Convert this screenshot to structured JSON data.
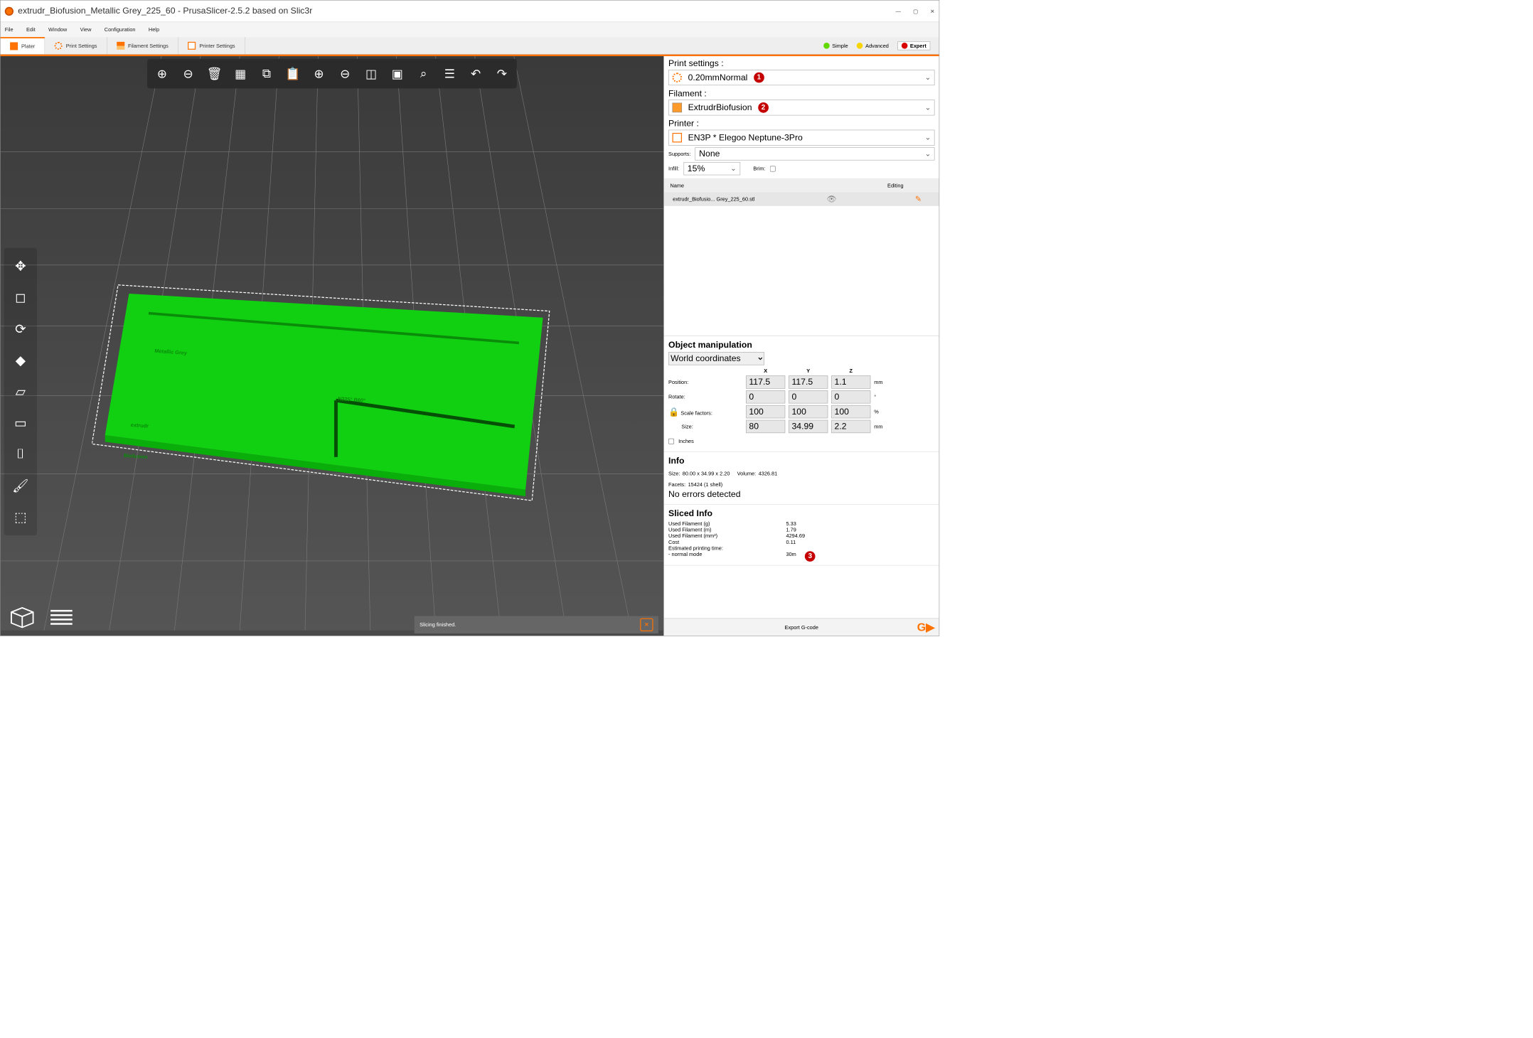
{
  "window": {
    "title": "extrudr_Biofusion_Metallic Grey_225_60 - PrusaSlicer-2.5.2 based on Slic3r"
  },
  "menu": {
    "file": "File",
    "edit": "Edit",
    "window": "Window",
    "view": "View",
    "configuration": "Configuration",
    "help": "Help"
  },
  "tabs": {
    "plater": "Plater",
    "print": "Print Settings",
    "filament": "Filament Settings",
    "printer": "Printer Settings"
  },
  "modes": {
    "simple": "Simple",
    "advanced": "Advanced",
    "expert": "Expert"
  },
  "right": {
    "printSettings": {
      "label": "Print settings :",
      "value": "0.20mmNormal",
      "badge": "1"
    },
    "filament": {
      "label": "Filament :",
      "value": "ExtrudrBiofusion",
      "badge": "2"
    },
    "printer": {
      "label": "Printer :",
      "value": "EN3P * Elegoo Neptune-3Pro"
    },
    "supports": {
      "label": "Supports:",
      "value": "None"
    },
    "infill": {
      "label": "Infill:",
      "value": "15%",
      "brimLabel": "Brim:"
    },
    "list": {
      "nameHdr": "Name",
      "editHdr": "Editing",
      "item": "extrudr_Biofusio... Grey_225_60.stl"
    }
  },
  "manip": {
    "header": "Object manipulation",
    "coord": "World coordinates",
    "cols": {
      "x": "X",
      "y": "Y",
      "z": "Z"
    },
    "position": {
      "label": "Position:",
      "x": "117.5",
      "y": "117.5",
      "z": "1.1",
      "unit": "mm"
    },
    "rotate": {
      "label": "Rotate:",
      "x": "0",
      "y": "0",
      "z": "0",
      "unit": "°"
    },
    "scale": {
      "label": "Scale factors:",
      "x": "100",
      "y": "100",
      "z": "100",
      "unit": "%"
    },
    "size": {
      "label": "Size:",
      "x": "80",
      "y": "34.99",
      "z": "2.2",
      "unit": "mm"
    },
    "inches": "Inches"
  },
  "info": {
    "header": "Info",
    "sizeLbl": "Size:",
    "sizeVal": "80.00 x 34.99 x 2.20",
    "volLbl": "Volume:",
    "volVal": "4326.81",
    "facetsLbl": "Facets:",
    "facetsVal": "15424 (1 shell)",
    "errors": "No errors detected"
  },
  "sliced": {
    "header": "Sliced Info",
    "g": {
      "k": "Used Filament (g)",
      "v": "5.33"
    },
    "m": {
      "k": "Used Filament (m)",
      "v": "1.79"
    },
    "mm3": {
      "k": "Used Filament (mm³)",
      "v": "4294.69"
    },
    "cost": {
      "k": "Cost",
      "v": "0.11"
    },
    "eta": {
      "k": "Estimated printing time:",
      "mode": "   - normal mode",
      "v": "30m",
      "badge": "3"
    }
  },
  "status": {
    "msg": "Slicing finished."
  },
  "export": {
    "label": "Export G-code"
  },
  "model": {
    "line1": "Metallic Grey",
    "line2": "N225° B60°",
    "line3": "extrudr",
    "line4": "Biofusion"
  }
}
